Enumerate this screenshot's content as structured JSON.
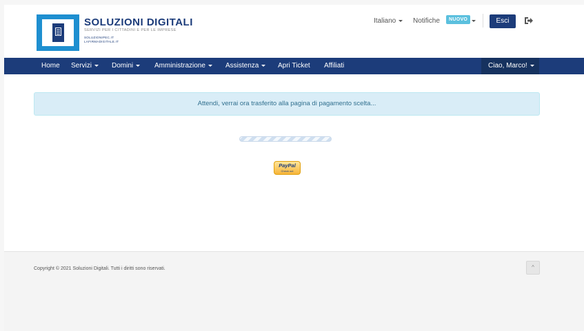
{
  "brand": {
    "title": "SOLUZIONI DIGITALI",
    "subtitle": "SERVIZI PER I CITTADINI E PER LE IMPRESE",
    "link1": "SOLUZIONIPEC.IT",
    "link2": "LAFIRMADIGITALE.IT"
  },
  "top": {
    "language": "Italiano",
    "notifications": "Notifiche",
    "badge": "NUOVO",
    "logout": "Esci"
  },
  "nav": {
    "items": [
      "Home",
      "Servizi",
      "Domini",
      "Amministrazione",
      "Assistenza",
      "Apri Ticket",
      "Affiliati"
    ],
    "user": "Ciao, Marco!"
  },
  "main": {
    "message": "Attendi, verrai ora trasferito alla pagina di pagamento scelta...",
    "paypal_line1": "PayPal",
    "paypal_line2": "Check out"
  },
  "footer": {
    "copyright": "Copyright © 2021 Soluzioni Digitali. Tutti i diritti sono riservati.",
    "back_to_top": "^"
  },
  "colors": {
    "brand_navy": "#1c3c7a",
    "brand_blue": "#1e8fd0",
    "alert_bg": "#d9edf7",
    "badge": "#5bc0de"
  }
}
